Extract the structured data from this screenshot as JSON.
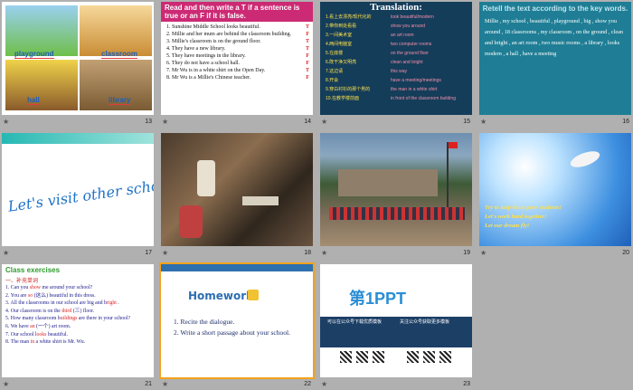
{
  "slides": [
    {
      "num": "13",
      "labels": [
        "playground",
        "classroom",
        "hall",
        "library"
      ]
    },
    {
      "num": "14",
      "header": "Read and then write a T if a sentence is true or an F if it is false.",
      "items": [
        {
          "text": "1. Sunshine Middle School looks beautiful.",
          "ans": "T"
        },
        {
          "text": "2. Millie and her mum are behind the classroom building.",
          "ans": "F"
        },
        {
          "text": "3. Millie's classroom is on the ground floor.",
          "ans": "T"
        },
        {
          "text": "4. They have a new library.",
          "ans": "T"
        },
        {
          "text": "5. They have meetings in the library.",
          "ans": "F"
        },
        {
          "text": "6. They do not have a school hall.",
          "ans": "F"
        },
        {
          "text": "7. Mr Wu is in a white shirt on the Open Day.",
          "ans": "T"
        },
        {
          "text": "8. Mr Wu is a Millie's Chinese teacher.",
          "ans": "F"
        }
      ]
    },
    {
      "num": "15",
      "title": "Translation:",
      "rows": [
        {
          "cn": "1.看上去漂亮/现代化的",
          "en": "look beautiful/modern"
        },
        {
          "cn": "2.带你到处看看",
          "en": "show you around"
        },
        {
          "cn": "3.一间美术室",
          "en": "an art room"
        },
        {
          "cn": "4.两间电脑室",
          "en": "two computer rooms"
        },
        {
          "cn": "5.在底楼",
          "en": "on the ground floor"
        },
        {
          "cn": "6.既干净又明亮",
          "en": "clean and bright"
        },
        {
          "cn": "7.这边请",
          "en": "this way"
        },
        {
          "cn": "8.开会",
          "en": "have a meeting/meetings"
        },
        {
          "cn": "9.穿白衬衫的那个男的",
          "en": "the man in a white shirt"
        },
        {
          "cn": "10.在教学楼前面",
          "en": "in front of the classroom building"
        }
      ]
    },
    {
      "num": "16",
      "title": "Retell the text according to the key words.",
      "body": "Millie , my school , beautiful , playground , big , show you around , 18 classrooms , my classroom , on the ground , clean and bright , an art room , two music rooms , a library , looks modern , a hall , have a meeting"
    },
    {
      "num": "17",
      "text": "Let's visit other schools!"
    },
    {
      "num": "18"
    },
    {
      "num": "19"
    },
    {
      "num": "20",
      "lines": [
        "Try to help those poor students!",
        "Let's work hard together!",
        "Let our dream fly!"
      ]
    },
    {
      "num": "21",
      "heading": "Class exercises",
      "sub": "一、补充单词",
      "lines": [
        {
          "a": "1. Can you ",
          "b": "show",
          "c": " me around your school?"
        },
        {
          "a": "2. You are ",
          "b": "so",
          "c": " (这么) beautiful in this dress."
        },
        {
          "a": "3. All the classrooms in our school are big and b",
          "b": "right",
          "c": " ."
        },
        {
          "a": "4. Our classroom is on the ",
          "b": "third",
          "c": " (三) floor."
        },
        {
          "a": "5. How many classroom b",
          "b": "uildings",
          "c": " are there in your school?"
        },
        {
          "a": "6. We have ",
          "b": "an",
          "c": " (一个) art room."
        },
        {
          "a": "7. Our school l",
          "b": "ooks",
          "c": " beautiful."
        },
        {
          "a": "8. The man ",
          "b": "in",
          "c": " a white shirt is Mr. Wu."
        }
      ]
    },
    {
      "num": "22",
      "logo": "Homework",
      "items": [
        "1.  Recite the dialogue.",
        "2.  Write a short passage about your school."
      ]
    },
    {
      "num": "23",
      "brand": "第1PPT",
      "bar_left": "可以在公众号下载优质模板",
      "bar_right": "关注公众号获取更多模板"
    }
  ],
  "star_icon": "★"
}
